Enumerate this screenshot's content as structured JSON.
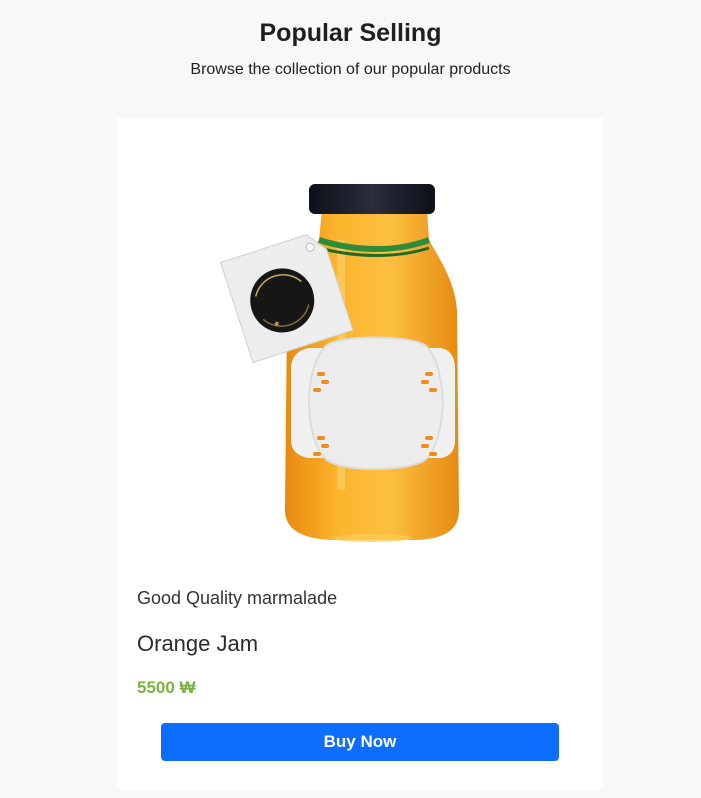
{
  "section": {
    "title": "Popular Selling",
    "subtitle": "Browse the collection of our popular products"
  },
  "product": {
    "description": "Good Quality marmalade",
    "name": "Orange Jam",
    "price": "5500 ₩",
    "buy_label": "Buy Now",
    "image_icon": "orange-jam-bottle-image",
    "colors": {
      "price": "#7cb342",
      "button": "#0d6efd",
      "jam": "#f7a823"
    }
  }
}
